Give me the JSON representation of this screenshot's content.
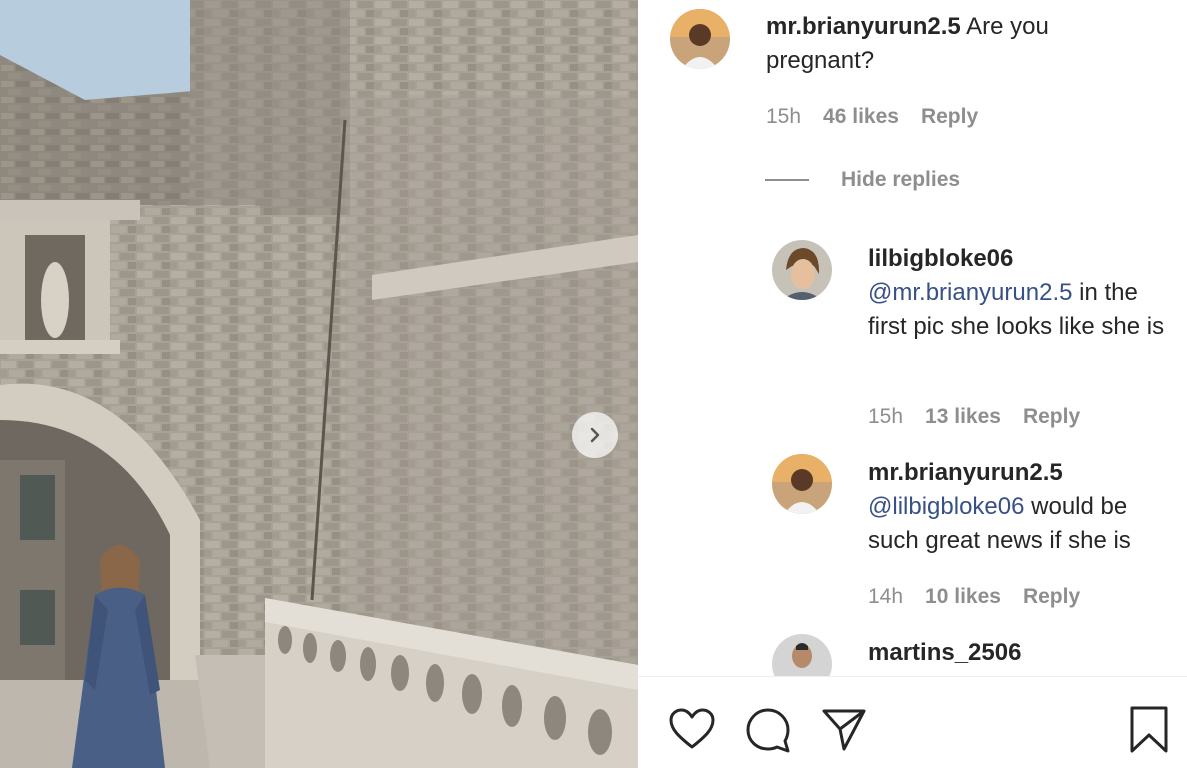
{
  "post": {
    "carousel_next_icon": "chevron-right-icon"
  },
  "comments": {
    "top": {
      "username": "mr.brianyurun2.5",
      "text": " Are you pregnant?",
      "time": "15h",
      "likes": "46 likes",
      "reply": "Reply"
    },
    "hide_replies": "Hide replies",
    "replies": [
      {
        "username": "lilbigbloke06",
        "mention": "@mr.brianyurun2.5",
        "text": " in the first pic she looks like she is",
        "time": "15h",
        "likes": "13 likes",
        "reply": "Reply"
      },
      {
        "username": "mr.brianyurun2.5",
        "mention": "@lilbigbloke06",
        "text": " would be such great news if she is",
        "time": "14h",
        "likes": "10 likes",
        "reply": "Reply"
      },
      {
        "username": "martins_2506"
      }
    ]
  },
  "actions": {
    "like_icon": "heart-icon",
    "comment_icon": "comment-icon",
    "share_icon": "paper-plane-icon",
    "save_icon": "bookmark-icon"
  },
  "colors": {
    "text": "#262626",
    "muted": "#8e8e8e",
    "mention": "#385185"
  }
}
